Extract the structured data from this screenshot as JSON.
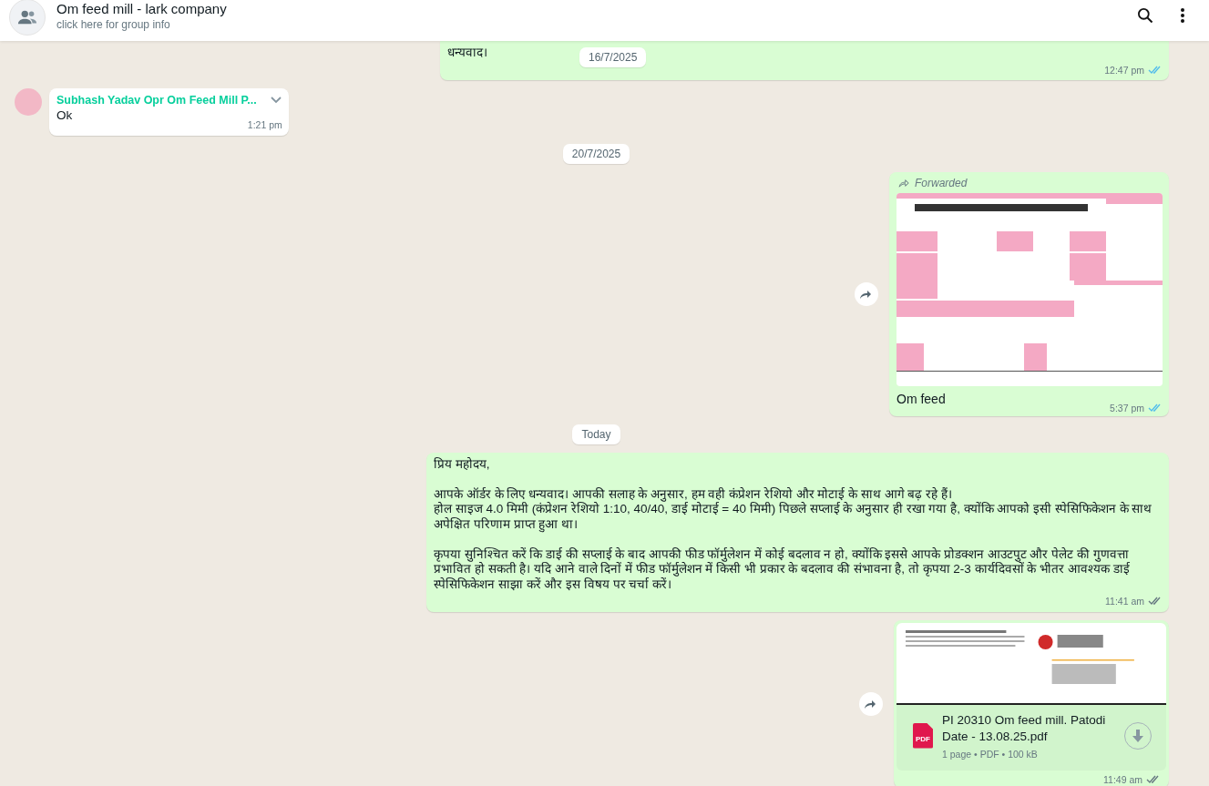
{
  "header": {
    "title": "Om feed mill - lark company",
    "subtitle": "click here for group info"
  },
  "sticky_date": "16/7/2025",
  "messages": [
    {
      "kind": "text",
      "outgoing": true,
      "text": "धन्यवाद।",
      "time": "12:47 pm",
      "read": true
    },
    {
      "kind": "text",
      "outgoing": false,
      "sender": "Subhash Yadav Opr Om Feed Mill P...",
      "text": "Ok",
      "time": "1:21 pm"
    },
    {
      "kind": "date",
      "text": "20/7/2025"
    },
    {
      "outgoing": true,
      "forwarded": "Forwarded",
      "caption": "Om feed",
      "time": "5:37 pm",
      "read": true
    },
    {
      "kind": "date",
      "text": "Today"
    },
    {
      "kind": "text",
      "outgoing": true,
      "text": "प्रिय महोदय,\n\nआपके ऑर्डर के लिए धन्यवाद। आपकी सलाह के अनुसार, हम वही कंप्रेशन रेशियो और मोटाई के साथ आगे बढ़ रहे हैं।\nहोल साइज 4.0 मिमी (कंप्रेशन रेशियो 1:10, 40/40, डाई मोटाई = 40 मिमी) पिछले सप्लाई के अनुसार ही रखा गया है, क्योंकि आपको इसी स्पेसिफिकेशन के साथ अपेक्षित परिणाम प्राप्त हुआ था।\n\nकृपया सुनिश्चित करें कि डाई की सप्लाई के बाद आपकी फीड फॉर्मुलेशन में कोई बदलाव न हो, क्योंकि इससे आपके प्रोडक्शन आउटपुट और पेलेट की गुणवत्ता प्रभावित हो सकती है। यदि आने वाले दिनों में फीड फॉर्मुलेशन में किसी भी प्रकार के बदलाव की संभावना है, तो कृपया 2-3 कार्यदिवसों के भीतर आवश्यक डाई स्पेसिफिकेशन साझा करें और इस विषय पर चर्चा करें।",
      "time": "11:41 am",
      "read": false
    },
    {
      "kind": "document",
      "outgoing": true,
      "file_name": "PI 20310 Om feed mill. Patodi Date - 13.08.25.pdf",
      "file_type": "PDF",
      "file_meta": "1 page • PDF • 100 kB",
      "time": "11:49 am",
      "read": false
    }
  ]
}
